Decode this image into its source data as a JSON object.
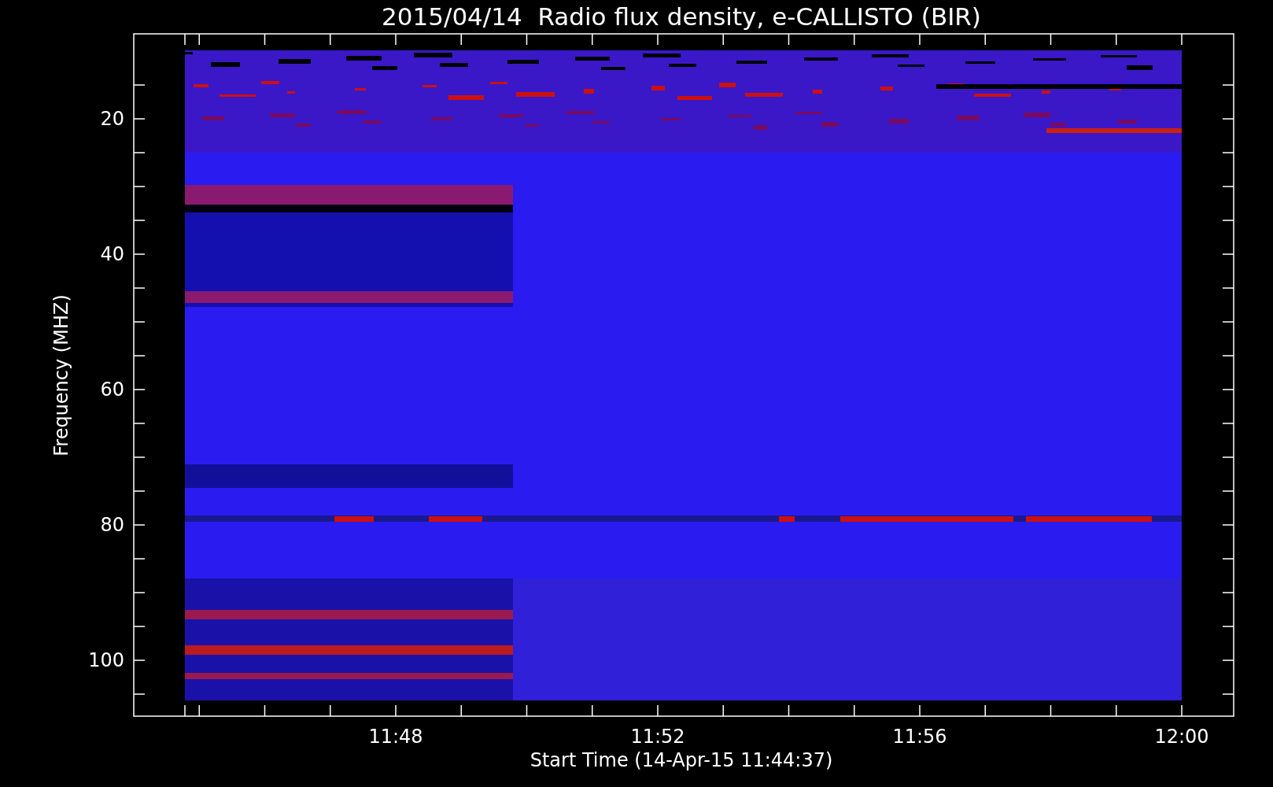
{
  "title": "2015/04/14  Radio flux density, e-CALLISTO (BIR)",
  "x_axis": {
    "label": "Start Time (14-Apr-15 11:44:37)",
    "ticks": [
      "11:48",
      "11:52",
      "11:56",
      "12:00"
    ]
  },
  "y_axis": {
    "label": "Frequency (MHZ)",
    "ticks": [
      "20",
      "40",
      "60",
      "80",
      "100"
    ]
  }
}
